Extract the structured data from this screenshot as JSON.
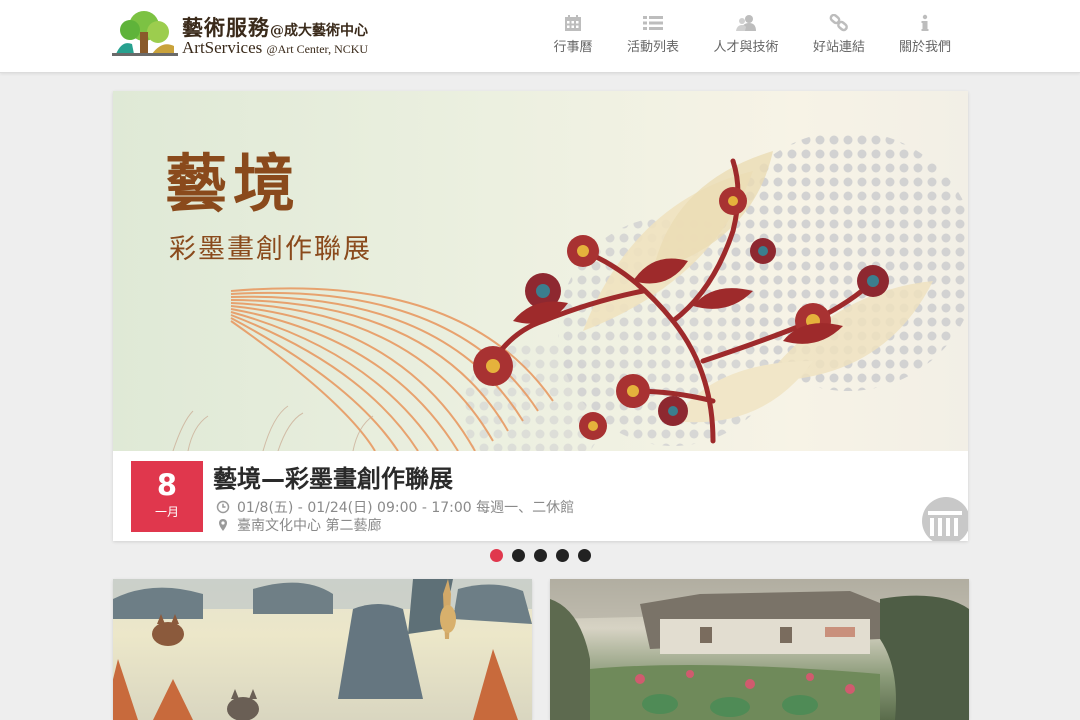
{
  "site": {
    "logo_zh": "藝術服務",
    "logo_zh_sub": "@成大藝術中心",
    "logo_en": "ArtServices",
    "logo_en_sub": "@Art Center, NCKU"
  },
  "nav": {
    "items": [
      {
        "label": "行事曆",
        "icon": "calendar-icon"
      },
      {
        "label": "活動列表",
        "icon": "list-icon"
      },
      {
        "label": "人才與技術",
        "icon": "people-icon"
      },
      {
        "label": "好站連結",
        "icon": "link-icon"
      },
      {
        "label": "關於我們",
        "icon": "info-icon"
      }
    ]
  },
  "hero": {
    "art_title": "藝境",
    "art_subtitle": "彩墨畫創作聯展",
    "badge_day": "8",
    "badge_month": "一月",
    "title": "藝境—彩墨畫創作聯展",
    "time": "01/8(五) - 01/24(日) 09:00 - 17:00 每週一、二休館",
    "place": "臺南文化中心 第二藝廊",
    "badge_color": "#e0374d"
  },
  "carousel": {
    "slide_count": 5,
    "active_index": 0,
    "active_color": "#e0374d"
  },
  "cards": [
    {
      "image": "forest-animals-painting"
    },
    {
      "image": "village-landscape-painting"
    }
  ]
}
